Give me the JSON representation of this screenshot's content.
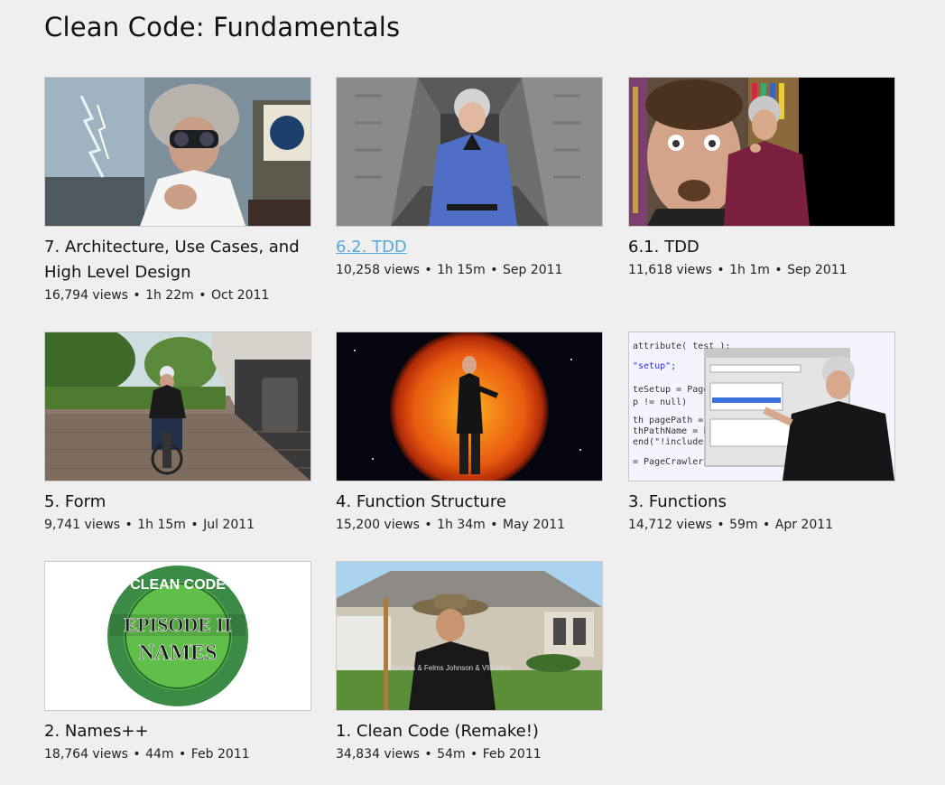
{
  "page": {
    "title": "Clean Code: Fundamentals"
  },
  "colors": {
    "background": "#efefef",
    "link_active": "#55a8d8",
    "text": "#111111"
  },
  "episodes": [
    {
      "title": "7. Architecture, Use Cases, and High Level Design",
      "views": "16,794 views",
      "duration": "1h 22m",
      "date": "Oct 2011",
      "active": false
    },
    {
      "title": "6.2. TDD",
      "views": "10,258 views",
      "duration": "1h 15m",
      "date": "Sep 2011",
      "active": true
    },
    {
      "title": "6.1. TDD",
      "views": "11,618 views",
      "duration": "1h 1m",
      "date": "Sep 2011",
      "active": false
    },
    {
      "title": "5. Form",
      "views": "9,741 views",
      "duration": "1h 15m",
      "date": "Jul 2011",
      "active": false
    },
    {
      "title": "4. Function Structure",
      "views": "15,200 views",
      "duration": "1h 34m",
      "date": "May 2011",
      "active": false
    },
    {
      "title": "3. Functions",
      "views": "14,712 views",
      "duration": "59m",
      "date": "Apr 2011",
      "active": false
    },
    {
      "title": "2. Names++",
      "views": "18,764 views",
      "duration": "44m",
      "date": "Feb 2011",
      "active": false
    },
    {
      "title": "1. Clean Code (Remake!)",
      "views": "34,834 views",
      "duration": "54m",
      "date": "Feb 2011",
      "active": false
    }
  ],
  "thumb_text": {
    "episode2_logo_top": "CLEAN CODE",
    "episode2_logo_main": "EPISODE II",
    "episode2_logo_sub": "NAMES",
    "episode3_code_1": "attribute( test );",
    "episode3_code_2": "\"setup\";",
    "episode3_code_3": "teSetup = PageCrawler",
    "episode3_code_4": "p != null)",
    "episode3_code_5": "th pagePath = crawl",
    "episode3_code_6": "thPathName = PathPar",
    "episode3_code_7": "end(\"!include -\" +",
    "episode3_code_8": "= PageCrawlerImpl.g",
    "episode1_shirt": "Samma & Felms Johnson & Vlissides"
  },
  "separator": "•"
}
